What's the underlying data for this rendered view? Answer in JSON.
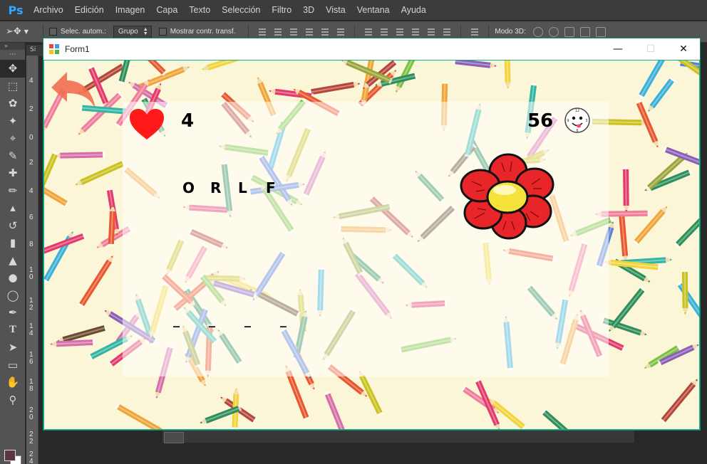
{
  "photoshop": {
    "logo": "Ps",
    "menu": [
      "Archivo",
      "Edición",
      "Imagen",
      "Capa",
      "Texto",
      "Selección",
      "Filtro",
      "3D",
      "Vista",
      "Ventana",
      "Ayuda"
    ],
    "options": {
      "auto_select_label": "Selec. autom.:",
      "auto_select_value": "Grupo",
      "show_transform_label": "Mostrar contr. transf.",
      "mode_3d_label": "Modo 3D:"
    },
    "toolbar_tab": "Si",
    "ruler_numbers": [
      "4",
      "2",
      "0",
      "2",
      "4",
      "6",
      "8",
      "1 0",
      "1 2",
      "1 4",
      "1 6",
      "1 8",
      "2 0",
      "2 2",
      "2 4"
    ],
    "colors": {
      "menubar": "#3c3c3c",
      "options": "#535353",
      "workspace": "#282828",
      "foreground_swatch": "#5d3545"
    }
  },
  "form": {
    "title": "Form1",
    "controls": {
      "minimize": "—",
      "maximize": "☐",
      "close": "✕"
    },
    "border_color": "#11b08f",
    "lives": "4",
    "score": "56",
    "scrambled_letters": [
      "O",
      "R",
      "L",
      "F"
    ],
    "answer_slots": [
      "_",
      "_",
      "_",
      "_"
    ],
    "icons": {
      "back": "back-arrow-icon",
      "lives": "heart-icon",
      "timer": "clock-icon",
      "hint": "flower-image"
    },
    "colors": {
      "heart": "#ff1a1a",
      "arrow": "#f26d4f",
      "flower_petal": "#e8262a",
      "flower_center": "#f5e33c",
      "background": "#fcf6d8"
    }
  }
}
